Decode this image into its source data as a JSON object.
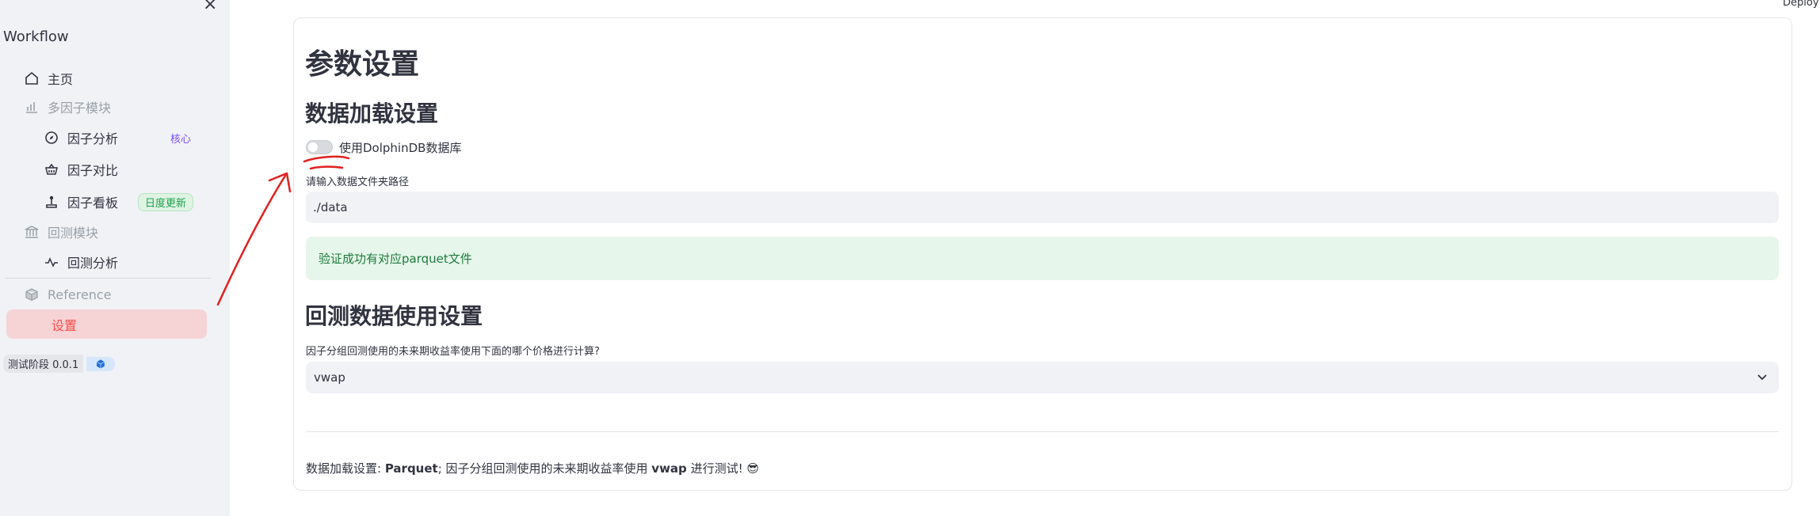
{
  "app": {
    "deploy_label": "Deploy",
    "close_label": "×"
  },
  "sidebar": {
    "title": "Workflow",
    "items": [
      {
        "label": "主页",
        "icon": "home-icon"
      },
      {
        "label": "多因子模块",
        "icon": "chart-bars-icon",
        "section": true
      },
      {
        "label": "因子分析",
        "icon": "compass-icon",
        "badge": "核心"
      },
      {
        "label": "因子对比",
        "icon": "basket-icon"
      },
      {
        "label": "因子看板",
        "icon": "joystick-icon",
        "badge": "日度更新"
      },
      {
        "label": "回测模块",
        "icon": "bank-icon",
        "section": true
      },
      {
        "label": "回测分析",
        "icon": "pulse-icon"
      },
      {
        "label": "Reference",
        "icon": "box-icon",
        "section": true
      },
      {
        "label": "设置",
        "active": true
      }
    ],
    "version_label": "测试阶段 0.0.1"
  },
  "main": {
    "title": "参数设置",
    "data_section": {
      "heading": "数据加载设置",
      "toggle_label": "使用DolphinDB数据库",
      "toggle_on": false,
      "path_label": "请输入数据文件夹路径",
      "path_value": "./data",
      "success_message": "验证成功有对应parquet文件"
    },
    "backtest_section": {
      "heading": "回测数据使用设置",
      "price_label": "因子分组回测使用的未来期收益率使用下面的哪个价格进行计算?",
      "price_value": "vwap"
    },
    "summary": {
      "prefix": "数据加载设置: ",
      "source": "Parquet",
      "middle": "; 因子分组回测使用的未来期收益率使用 ",
      "price": "vwap",
      "suffix": " 进行测试! 😎"
    }
  },
  "colors": {
    "accent": "#ff4b4b",
    "active_bg": "#f6d3d5",
    "success_bg": "#e6f6ea",
    "annotation": "#e02020"
  }
}
